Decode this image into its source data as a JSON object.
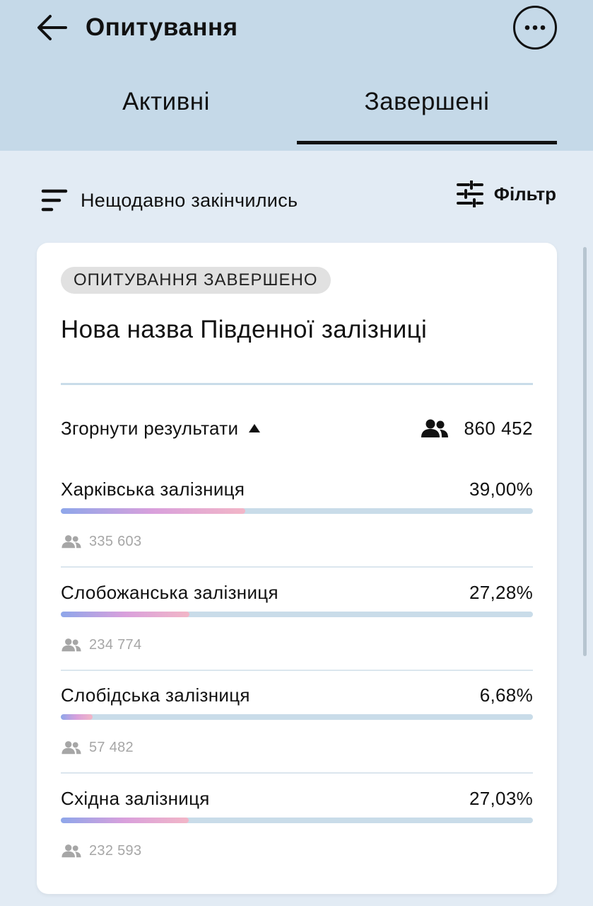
{
  "header": {
    "title": "Опитування",
    "back_icon": "arrow-left-icon",
    "more_icon": "more-horizontal-icon"
  },
  "tabs": [
    {
      "label": "Активні",
      "selected": false
    },
    {
      "label": "Завершені",
      "selected": true
    }
  ],
  "toolbar": {
    "sort_label": "Нещодавно закінчились",
    "sort_icon": "sort-icon",
    "filter_label": "Фільтр",
    "filter_icon": "sliders-icon"
  },
  "poll": {
    "status_badge": "ОПИТУВАННЯ ЗАВЕРШЕНО",
    "title": "Нова назва Південної залізниці",
    "collapse_label": "Згорнути результати",
    "total_votes": "860 452",
    "options": [
      {
        "name": "Харківська залізниця",
        "percent": "39,00%",
        "share": 39.0,
        "votes": "335 603"
      },
      {
        "name": "Слобожанська залізниця",
        "percent": "27,28%",
        "share": 27.28,
        "votes": "234 774"
      },
      {
        "name": "Слобідська залізниця",
        "percent": "6,68%",
        "share": 6.68,
        "votes": "57 482"
      },
      {
        "name": "Східна залізниця",
        "percent": "27,03%",
        "share": 27.03,
        "votes": "232 593"
      }
    ]
  },
  "colors": {
    "header_bg": "#c5d9e8",
    "page_bg": "#e2ebf4",
    "bar_track": "#c9dce9",
    "bar_gradient": [
      "#8ea6ea",
      "#d9a0dc",
      "#f2b6c7"
    ]
  }
}
